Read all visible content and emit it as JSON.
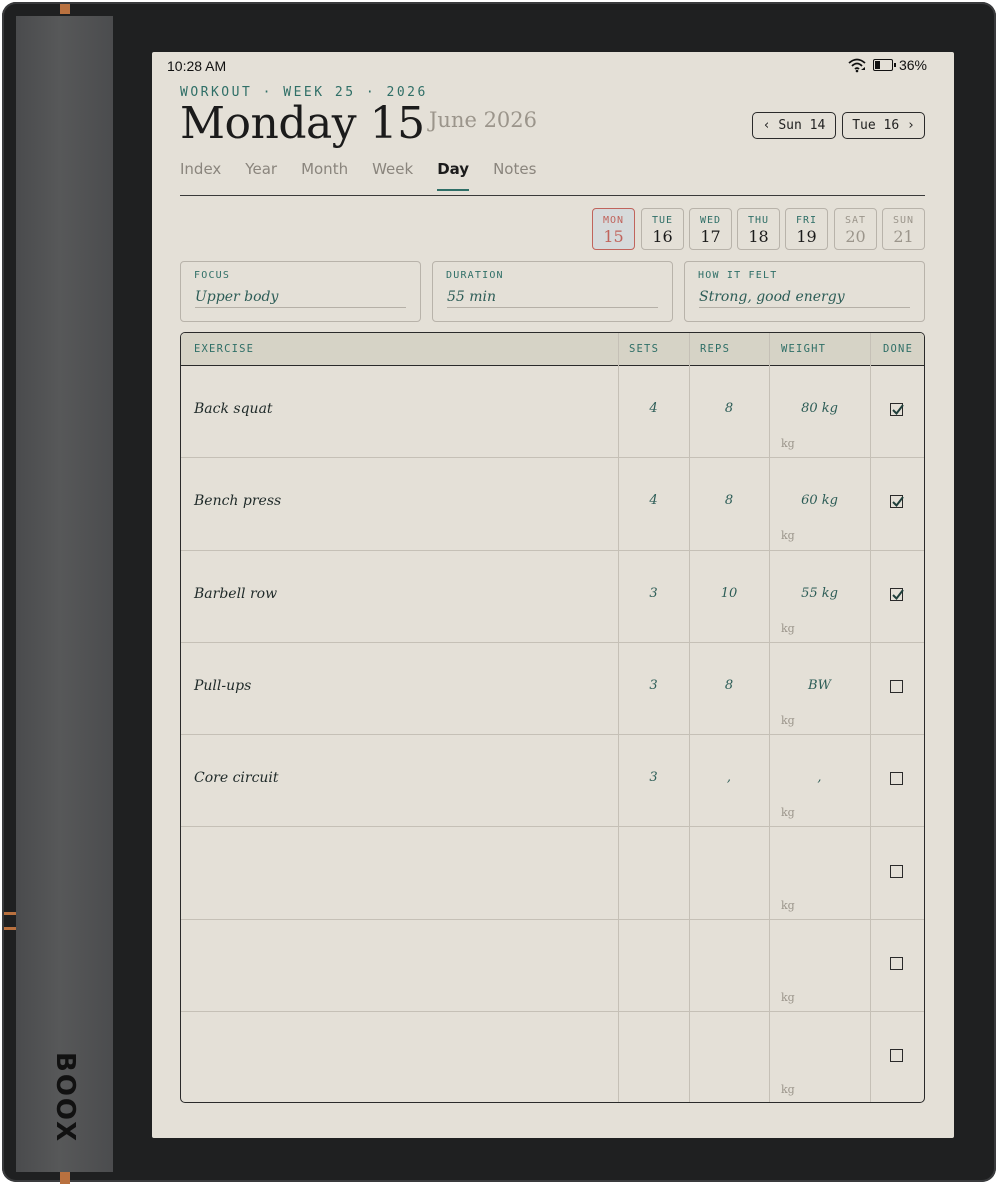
{
  "device": {
    "brand": "BOOX"
  },
  "status": {
    "time": "10:28 AM",
    "battery": "36%",
    "battery_level": 0.36
  },
  "header": {
    "kicker": "WORKOUT · WEEK 25 · 2026",
    "title": "Monday 15",
    "subtitle": "June 2026",
    "prev_label": "‹ Sun 14",
    "next_label": "Tue 16 ›"
  },
  "tabs": [
    {
      "label": "Index"
    },
    {
      "label": "Year"
    },
    {
      "label": "Month"
    },
    {
      "label": "Week"
    },
    {
      "label": "Day",
      "active": true
    },
    {
      "label": "Notes"
    }
  ],
  "week_days": [
    {
      "name": "MON",
      "date": "15",
      "current": true
    },
    {
      "name": "TUE",
      "date": "16"
    },
    {
      "name": "WED",
      "date": "17"
    },
    {
      "name": "THU",
      "date": "18"
    },
    {
      "name": "FRI",
      "date": "19"
    },
    {
      "name": "SAT",
      "date": "20",
      "weekend": true
    },
    {
      "name": "SUN",
      "date": "21",
      "weekend": true
    }
  ],
  "summary": {
    "focus": {
      "label": "FOCUS",
      "value": "Upper body"
    },
    "duration": {
      "label": "DURATION",
      "value": "55 min"
    },
    "felt": {
      "label": "HOW IT FELT",
      "value": "Strong, good energy"
    }
  },
  "table": {
    "headers": {
      "exercise": "EXERCISE",
      "sets": "SETS",
      "reps": "REPS",
      "weight": "WEIGHT",
      "done": "DONE"
    },
    "unit": "kg",
    "rows": [
      {
        "exercise": "Back squat",
        "sets": "4",
        "reps": "8",
        "weight": "80 kg",
        "done": true
      },
      {
        "exercise": "Bench press",
        "sets": "4",
        "reps": "8",
        "weight": "60 kg",
        "done": true
      },
      {
        "exercise": "Barbell row",
        "sets": "3",
        "reps": "10",
        "weight": "55 kg",
        "done": true
      },
      {
        "exercise": "Pull-ups",
        "sets": "3",
        "reps": "8",
        "weight": "BW",
        "done": false
      },
      {
        "exercise": "Core circuit",
        "sets": "3",
        "reps": ",",
        "weight": ",",
        "done": false
      },
      {
        "exercise": "",
        "sets": "",
        "reps": "",
        "weight": "",
        "done": false
      },
      {
        "exercise": "",
        "sets": "",
        "reps": "",
        "weight": "",
        "done": false
      },
      {
        "exercise": "",
        "sets": "",
        "reps": "",
        "weight": "",
        "done": false
      }
    ]
  }
}
